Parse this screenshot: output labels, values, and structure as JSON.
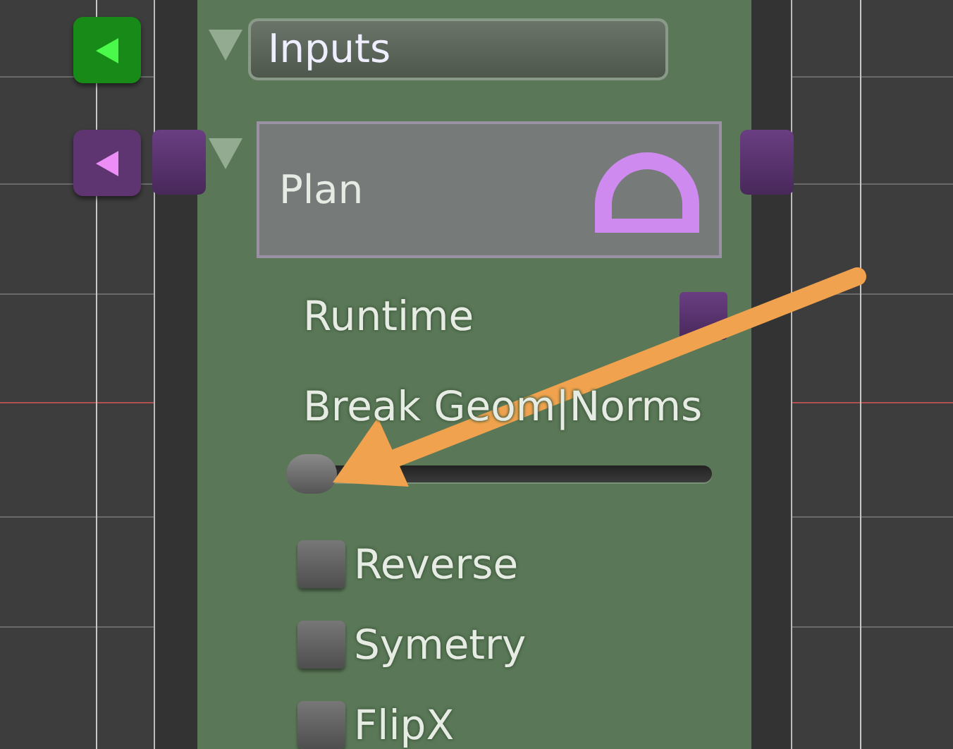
{
  "input_ports": [
    {
      "color": "#178a17"
    },
    {
      "color": "#5e3570"
    }
  ],
  "inputs_header": {
    "label": "Inputs",
    "expanded": true
  },
  "plan": {
    "label": "Plan",
    "expanded": true
  },
  "fields": [
    {
      "kind": "port",
      "label": "Runtime"
    },
    {
      "kind": "slider",
      "label": "Break Geom|Norms",
      "level": 0
    },
    {
      "kind": "checkbox",
      "label": "Reverse",
      "checked": false
    },
    {
      "kind": "checkbox",
      "label": "Symetry",
      "checked": false
    },
    {
      "kind": "checkbox",
      "label": "FlipX",
      "checked": false
    }
  ]
}
